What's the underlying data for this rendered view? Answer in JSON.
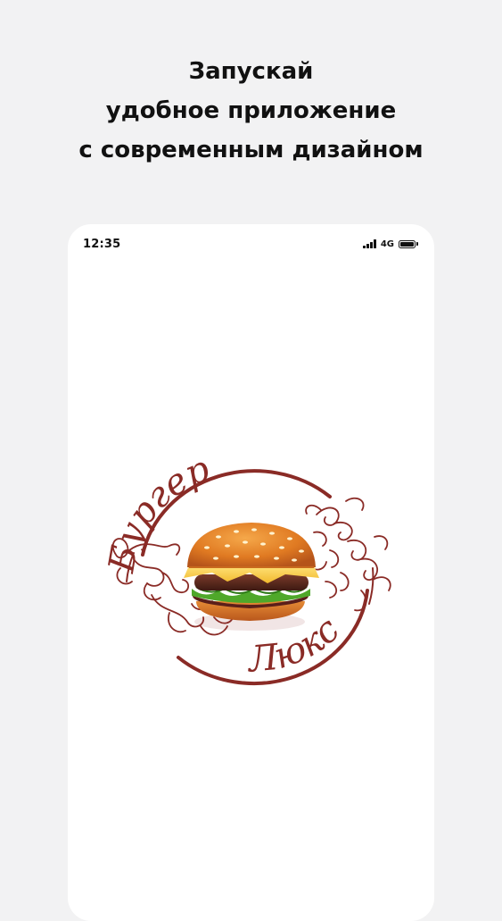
{
  "headline": {
    "line1": "Запускай",
    "line2": "удобное приложение",
    "line3": "с современным дизайном"
  },
  "status_bar": {
    "time": "12:35",
    "network": "4G",
    "battery_level": 1.0
  },
  "logo": {
    "brand_word_1": "Бургер",
    "brand_word_2": "Люкс",
    "brand_color": "#8a2b26"
  }
}
